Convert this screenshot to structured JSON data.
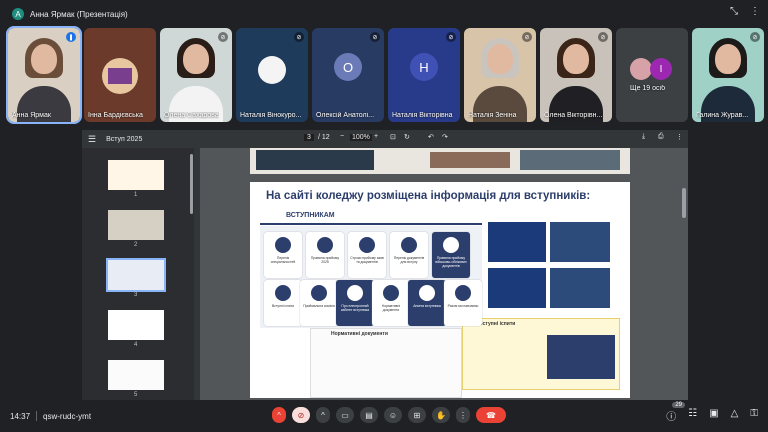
{
  "top": {
    "presenter_initial": "A",
    "presenter_title": "Анна Ярмак (Презентація)"
  },
  "tiles": [
    {
      "name": "Анна Ярмак",
      "kind": "video"
    },
    {
      "name": "Інна Бардієвська",
      "kind": "video"
    },
    {
      "name": "Олена Сахарова",
      "kind": "video"
    },
    {
      "name": "Наталія Вінокуро...",
      "kind": "video"
    },
    {
      "name": "Олексій Анатолі...",
      "kind": "letter",
      "letter": "О",
      "color": "#5f6a9e"
    },
    {
      "name": "Наталія Вікторівна",
      "kind": "letter",
      "letter": "Н",
      "color": "#3f51b5"
    },
    {
      "name": "Наталія Зеніна",
      "kind": "video"
    },
    {
      "name": "Олена Вікторівн...",
      "kind": "video"
    },
    {
      "name": "Ще 19 осіб",
      "kind": "more",
      "letter": "I",
      "color": "#9c27b0"
    },
    {
      "name": "Галина Журав...",
      "kind": "video"
    }
  ],
  "pdf": {
    "title": "Вступ 2025",
    "page_current": "3",
    "page_total": "/ 12",
    "zoom": "100%",
    "thumb_numbers": [
      "1",
      "2",
      "3",
      "4",
      "5"
    ]
  },
  "slide": {
    "heading": "На сайті коледжу розміщена інформація  для вступників:",
    "tab_label": "ВСТУПНИКАМ",
    "cards_row1": [
      "Перелік спеціальностей",
      "Правила прийому 2025",
      "Строки прийому заяв та документів",
      "Перелік документів для вступу",
      "Правила прийому військово-облікових документів"
    ],
    "cards_row2": [
      "Вступні іспити",
      "Приймальна комісія",
      "Про електронний кабінет вступника",
      "Нормативні документи",
      "Анкета вступника",
      "Разом ми навчаємо"
    ],
    "normative_title": "Нормативні документи",
    "exams_title": "Вступні іспити"
  },
  "bottom": {
    "clock": "14:37",
    "meet_code": "qsw-rudc-ymt",
    "participants_badge": "29"
  },
  "colors": {
    "accent_blue": "#8ab4f8",
    "end_call_red": "#ea4335",
    "slide_navy": "#2c3e6b"
  }
}
